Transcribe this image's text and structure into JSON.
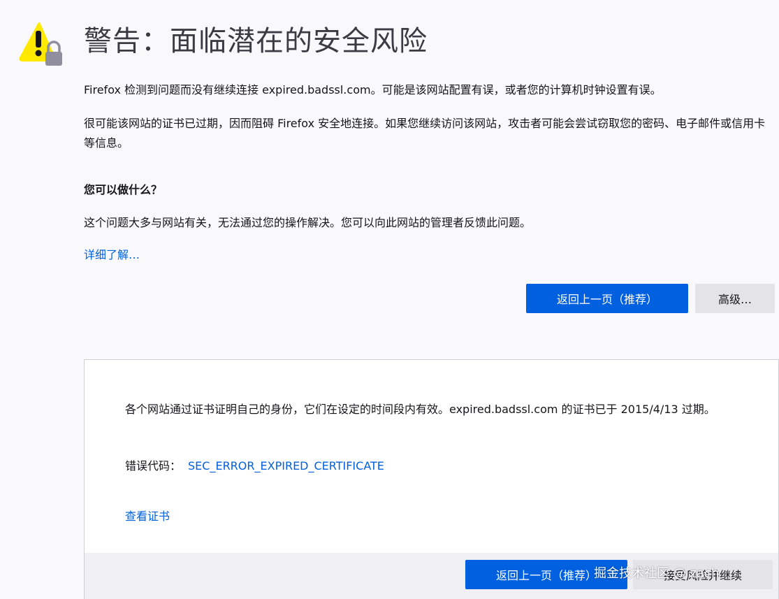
{
  "title": "警告：面临潜在的安全风险",
  "intro": "Firefox 检测到问题而没有继续连接 expired.badssl.com。可能是该网站配置有误，或者您的计算机时钟设置有误。",
  "detail": "很可能该网站的证书已过期，因而阻碍 Firefox 安全地连接。如果您继续访问该网站，攻击者可能会尝试窃取您的密码、电子邮件或信用卡等信息。",
  "what_heading": "您可以做什么？",
  "what_text": "这个问题大多与网站有关，无法通过您的操作解决。您可以向此网站的管理者反馈此问题。",
  "learn_more": "详细了解…",
  "buttons": {
    "go_back": "返回上一页（推荐）",
    "advanced": "高级…",
    "accept": "接受风险并继续"
  },
  "advanced": {
    "description": "各个网站通过证书证明自己的身份，它们在设定的时间段内有效。expired.badssl.com 的证书已于 2015/4/13 过期。",
    "error_label": "错误代码：",
    "error_code": "SEC_ERROR_EXPIRED_CERTIFICATE",
    "view_certificate": "查看证书"
  },
  "watermark": "掘金技术社区 @ zach",
  "icons": {
    "warning": "warning-triangle-icon",
    "lock": "lock-icon"
  },
  "colors": {
    "accent": "#0060df",
    "warning": "#ffe900",
    "background": "#f9f9fb"
  }
}
